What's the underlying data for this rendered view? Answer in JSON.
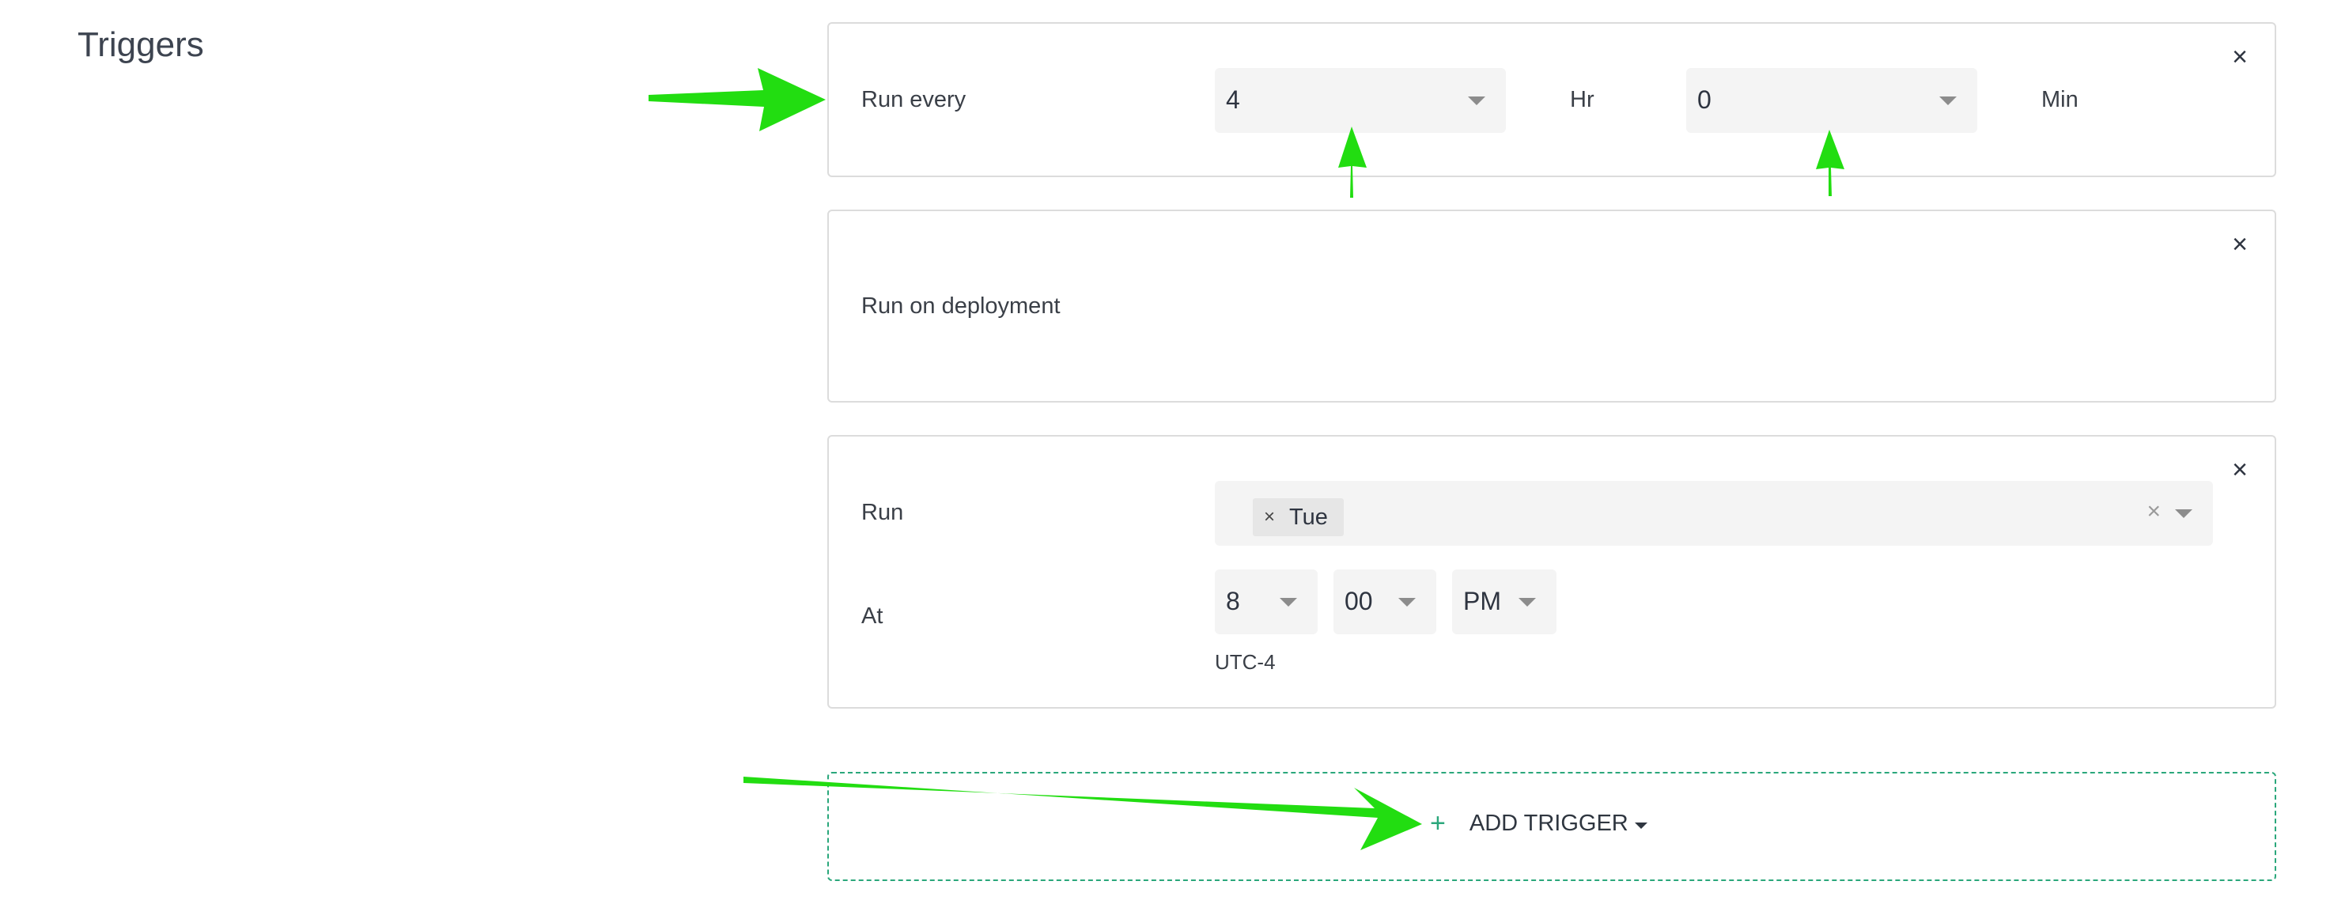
{
  "section": {
    "title": "Triggers"
  },
  "triggers": [
    {
      "label": "Run every",
      "hours": "4",
      "hours_unit": "Hr",
      "minutes": "0",
      "minutes_unit": "Min"
    },
    {
      "label": "Run on deployment"
    },
    {
      "run_label": "Run",
      "days": [
        "Tue"
      ],
      "at_label": "At",
      "hour": "8",
      "minute": "00",
      "ampm": "PM",
      "timezone": "UTC-4"
    }
  ],
  "add_trigger": {
    "icon": "+",
    "label": "ADD TRIGGER"
  },
  "icons": {
    "close": "×",
    "annotation_color": "#22dd11",
    "accent": "#2aa77b"
  }
}
